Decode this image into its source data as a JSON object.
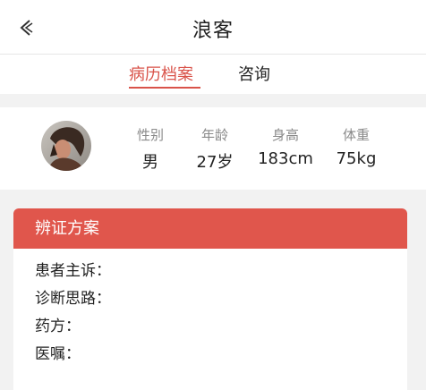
{
  "header": {
    "title": "浪客",
    "back_icon": "chevron-left-icon"
  },
  "tabs": [
    {
      "label": "病历档案",
      "active": true
    },
    {
      "label": "咨询",
      "active": false
    }
  ],
  "profile": {
    "avatar": "user-avatar",
    "stats": [
      {
        "label": "性别",
        "value": "男"
      },
      {
        "label": "年龄",
        "value": "27岁"
      },
      {
        "label": "身高",
        "value": "183cm"
      },
      {
        "label": "体重",
        "value": "75kg"
      }
    ]
  },
  "plan": {
    "title": "辨证方案",
    "rows": [
      "患者主诉：",
      "诊断思路：",
      "药方：",
      "医嘱："
    ]
  },
  "colors": {
    "accent": "#d9534a",
    "card_header": "#e0564c",
    "background": "#f2f2f2"
  }
}
